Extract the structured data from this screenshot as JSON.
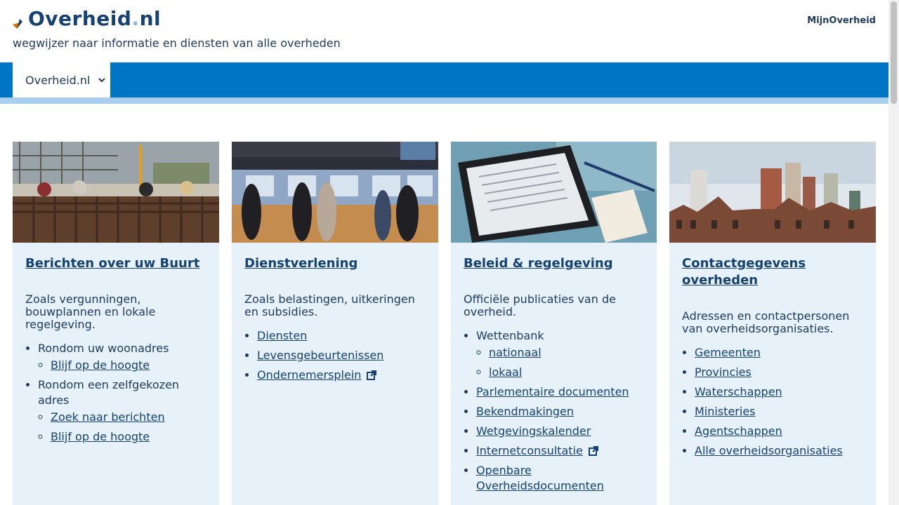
{
  "header": {
    "logo_main": "Overheid",
    "logo_dot": ".",
    "logo_suffix": "nl",
    "tagline": "wegwijzer naar informatie en diensten van alle overheden",
    "mijn_link": "MijnOverheid"
  },
  "nav": {
    "tab_label": "Overheid.nl"
  },
  "colors": {
    "brand_dark": "#154273",
    "nav_blue": "#0074c5",
    "card_bg": "#e6f1fa",
    "subbar": "#a8d0ee"
  },
  "cards": [
    {
      "title": "Berichten over uw Buurt",
      "desc": "Zoals vergunningen, bouwplannen en lokale regelgeving.",
      "groups": [
        {
          "label": "Rondom uw woonadres",
          "links": [
            "Blijf op de hoogte"
          ]
        },
        {
          "label": "Rondom een zelfgekozen adres",
          "links": [
            "Zoek naar berichten",
            "Blijf op de hoogte"
          ]
        }
      ]
    },
    {
      "title": "Dienstverlening",
      "desc": "Zoals belastingen, uitkeringen en subsidies.",
      "links": [
        "Diensten",
        "Levensgebeurtenissen",
        "Ondernemersplein"
      ]
    },
    {
      "title": "Beleid & regelgeving",
      "desc": "Officiële publicaties van de overheid.",
      "wettenbank": {
        "label": "Wettenbank",
        "links": [
          "nationaal",
          "lokaal"
        ]
      },
      "links": [
        "Parlementaire documenten",
        "Bekendmakingen",
        "Wetgevingskalender",
        "Internetconsultatie",
        "Openbare Overheidsdocumenten"
      ]
    },
    {
      "title": "Contactgegevens overheden",
      "desc": "Adressen en contactpersonen van overheidsorganisaties.",
      "links": [
        "Gemeenten",
        "Provincies",
        "Waterschappen",
        "Ministeries",
        "Agentschappen",
        "Alle overheidsorganisaties"
      ]
    }
  ]
}
